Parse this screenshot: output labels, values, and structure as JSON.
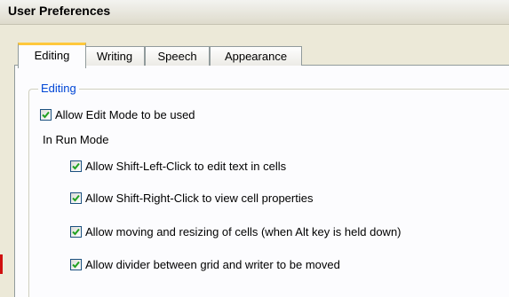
{
  "window": {
    "title": "User Preferences"
  },
  "tabs": [
    {
      "label": "Editing",
      "active": true
    },
    {
      "label": "Writing",
      "active": false
    },
    {
      "label": "Speech",
      "active": false
    },
    {
      "label": "Appearance",
      "active": false
    }
  ],
  "group": {
    "label": "Editing",
    "allow_edit_mode": {
      "label": "Allow Edit Mode to be used",
      "checked": true
    },
    "run_mode_heading": "In Run Mode",
    "run_mode_options": [
      {
        "label": "Allow Shift-Left-Click to edit text in cells",
        "checked": true
      },
      {
        "label": "Allow Shift-Right-Click to view cell properties",
        "checked": true
      },
      {
        "label": "Allow moving and resizing of cells (when Alt key is held down)",
        "checked": true
      },
      {
        "label": "Allow divider between grid and writer to be moved",
        "checked": true
      }
    ]
  },
  "colors": {
    "group_label": "#0046d5",
    "checkmark": "#21a121",
    "active_tab_highlight": "#ffc83c",
    "dialog_background": "#ece9d8",
    "panel_background": "#fcfcfe"
  }
}
